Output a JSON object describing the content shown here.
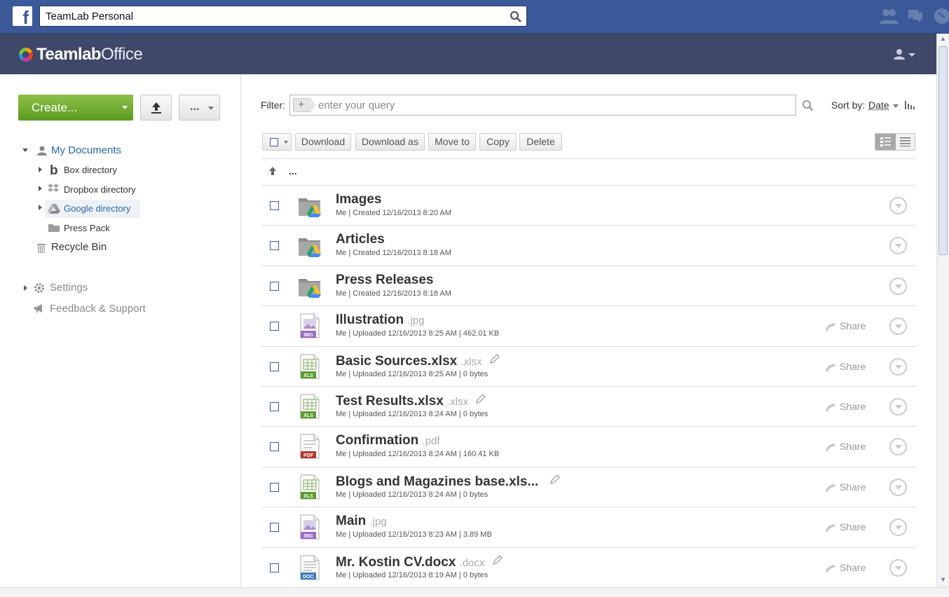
{
  "facebook": {
    "logo_letter": "f",
    "search_value": "TeamLab Personal"
  },
  "teamlab": {
    "logo_bold": "Teamlab",
    "logo_light": "Office"
  },
  "sidebar": {
    "create_label": "Create...",
    "more_label": "...",
    "tree": {
      "my_documents": "My Documents",
      "box": "Box directory",
      "dropbox": "Dropbox directory",
      "google": "Google directory",
      "press_pack": "Press Pack",
      "recycle_bin": "Recycle Bin"
    },
    "settings": "Settings",
    "feedback": "Feedback & Support"
  },
  "filter": {
    "label": "Filter:",
    "placeholder": "enter your query",
    "sort_label": "Sort by:",
    "sort_value": "Date"
  },
  "toolbar": {
    "download": "Download",
    "download_as": "Download as",
    "move_to": "Move to",
    "copy": "Copy",
    "delete": "Delete"
  },
  "parent_dir": "...",
  "files": [
    {
      "name": "Images",
      "ext": "",
      "meta": "Me | Created 12/16/2013 8:20 AM",
      "type": "folder",
      "share": "",
      "edit": false
    },
    {
      "name": "Articles",
      "ext": "",
      "meta": "Me | Created 12/16/2013 8:18 AM",
      "type": "folder",
      "share": "",
      "edit": false
    },
    {
      "name": "Press Releases",
      "ext": "",
      "meta": "Me | Created 12/16/2013 8:18 AM",
      "type": "folder",
      "share": "",
      "edit": false
    },
    {
      "name": "Illustration",
      "ext": ".jpg",
      "meta": "Me | Uploaded 12/16/2013 8:25 AM | 462.01 KB",
      "type": "IMG",
      "share": "Share",
      "edit": false
    },
    {
      "name": "Basic Sources.xlsx",
      "ext": ".xlsx",
      "meta": "Me | Uploaded 12/16/2013 8:25 AM | 0 bytes",
      "type": "XLS",
      "share": "Share",
      "edit": true
    },
    {
      "name": "Test Results.xlsx",
      "ext": ".xlsx",
      "meta": "Me | Uploaded 12/16/2013 8:24 AM | 0 bytes",
      "type": "XLS",
      "share": "Share",
      "edit": true
    },
    {
      "name": "Confirmation",
      "ext": ".pdf",
      "meta": "Me | Uploaded 12/16/2013 8:24 AM | 160.41 KB",
      "type": "PDF",
      "share": "Share",
      "edit": false
    },
    {
      "name": "Blogs and Magazines base.xls...",
      "ext": "",
      "meta": "Me | Uploaded 12/16/2013 8:24 AM | 0 bytes",
      "type": "XLS",
      "share": "Share",
      "edit": true
    },
    {
      "name": "Main",
      "ext": ".jpg",
      "meta": "Me | Uploaded 12/16/2013 8:23 AM | 3.89 MB",
      "type": "IMG",
      "share": "Share",
      "edit": false
    },
    {
      "name": "Mr. Kostin CV.docx",
      "ext": ".docx",
      "meta": "Me | Uploaded 12/16/2013 8:19 AM | 0 bytes",
      "type": "DOC",
      "share": "Share",
      "edit": true
    }
  ],
  "colors": {
    "facebook_blue": "#3b5998",
    "header": "#40486a",
    "create_green": "#72ad2f",
    "link_blue": "#2a6aad",
    "xls_green": "#5b9d2c",
    "pdf_red": "#b5352c",
    "img_purple": "#9b6bc4",
    "doc_blue": "#3b7bc0"
  },
  "icons": {
    "search": "search-icon",
    "upload": "upload-icon",
    "user": "user-icon",
    "settings": "gear-icon",
    "feedback": "megaphone-icon",
    "recycle": "trash-icon",
    "share": "share-icon",
    "pencil": "pencil-icon",
    "up": "arrow-up-icon"
  }
}
